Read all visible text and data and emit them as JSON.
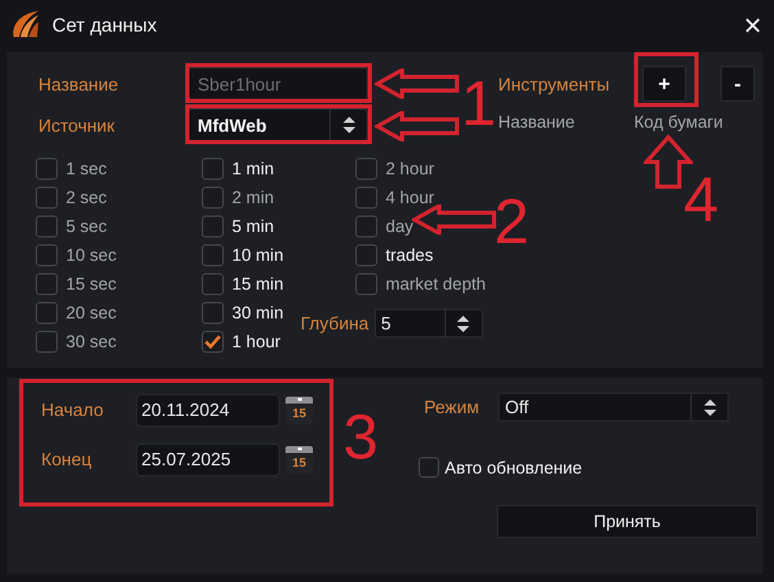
{
  "window": {
    "title": "Сет данных"
  },
  "name_field": {
    "label": "Название",
    "value": "Sber1hour",
    "disabled": true
  },
  "source": {
    "label": "Источник",
    "value": "MfdWeb"
  },
  "instruments": {
    "label": "Инструменты",
    "add_button": "+",
    "remove_button": "-",
    "columns": [
      "Название",
      "Код бумаги"
    ]
  },
  "timeframe_columns": [
    [
      {
        "label": "1 sec",
        "checked": false,
        "disabled": true
      },
      {
        "label": "2 sec",
        "checked": false,
        "disabled": true
      },
      {
        "label": "5 sec",
        "checked": false,
        "disabled": true
      },
      {
        "label": "10 sec",
        "checked": false,
        "disabled": true
      },
      {
        "label": "15 sec",
        "checked": false,
        "disabled": true
      },
      {
        "label": "20 sec",
        "checked": false,
        "disabled": true
      },
      {
        "label": "30 sec",
        "checked": false,
        "disabled": true
      }
    ],
    [
      {
        "label": "1 min",
        "checked": false,
        "disabled": false
      },
      {
        "label": "2 min",
        "checked": false,
        "disabled": true
      },
      {
        "label": "5 min",
        "checked": false,
        "disabled": false
      },
      {
        "label": "10 min",
        "checked": false,
        "disabled": false
      },
      {
        "label": "15 min",
        "checked": false,
        "disabled": false
      },
      {
        "label": "30 min",
        "checked": false,
        "disabled": false
      },
      {
        "label": "1 hour",
        "checked": true,
        "disabled": false
      }
    ],
    [
      {
        "label": "2 hour",
        "checked": false,
        "disabled": true
      },
      {
        "label": "4 hour",
        "checked": false,
        "disabled": true
      },
      {
        "label": "day",
        "checked": false,
        "disabled": true
      },
      {
        "label": "trades",
        "checked": false,
        "disabled": false
      },
      {
        "label": "market depth",
        "checked": false,
        "disabled": true
      }
    ]
  ],
  "depth": {
    "label": "Глубина",
    "value": "5"
  },
  "period": [
    {
      "label": "Начало",
      "value": "20.11.2024",
      "calendar_day": "15"
    },
    {
      "label": "Конец",
      "value": "25.07.2025",
      "calendar_day": "15"
    }
  ],
  "mode": {
    "label": "Режим",
    "value": "Off"
  },
  "auto_update": {
    "label": "Авто обновление",
    "checked": false
  },
  "accept_button": "Принять",
  "annotations": [
    "1",
    "2",
    "3",
    "4"
  ]
}
